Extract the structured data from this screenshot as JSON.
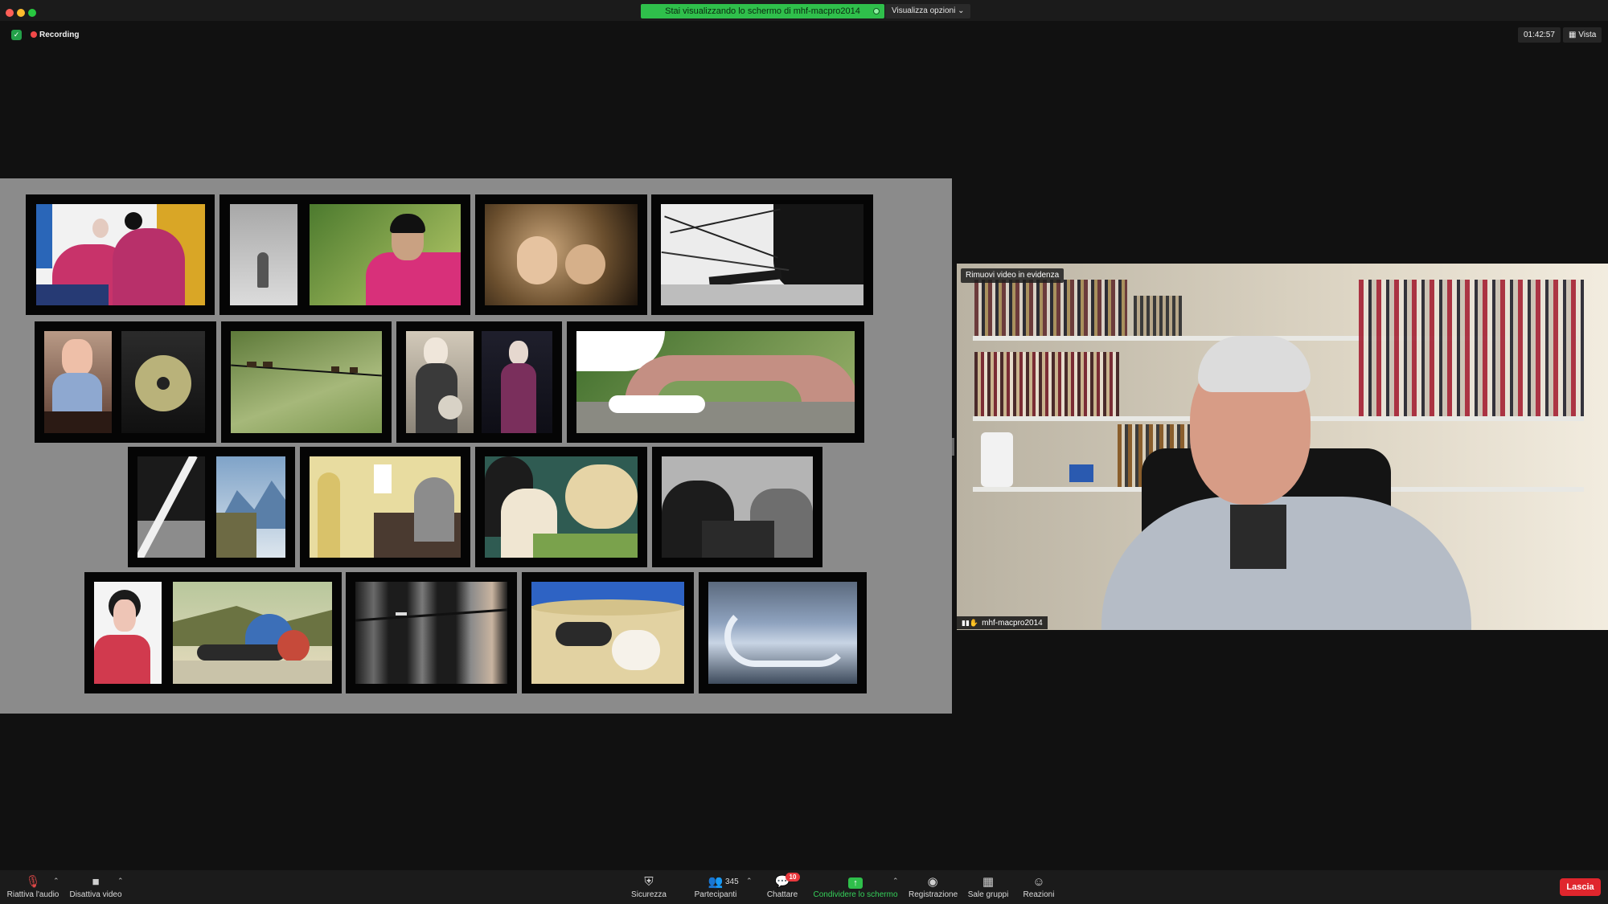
{
  "top_bar": {
    "share_banner": "Stai visualizzando lo schermo di mhf-macpro2014",
    "view_options": "Visualizza opzioni ⌄"
  },
  "status": {
    "recording_label": "Recording",
    "timer": "01:42:57",
    "view_button": "Vista"
  },
  "video": {
    "remove_spotlight": "Rimuovi video in evidenza",
    "participant_name": "mhf-macpro2014"
  },
  "toolbar": {
    "unmute": "Riattiva l'audio",
    "stop_video": "Disattiva video",
    "security": "Sicurezza",
    "participants": "Partecipanti",
    "participants_count": "345",
    "chat": "Chattare",
    "chat_badge": "10",
    "share_screen": "Condividere lo schermo",
    "record": "Registrazione",
    "breakout_rooms": "Sale gruppi",
    "reactions": "Reazioni",
    "leave": "Lascia"
  },
  "colors": {
    "accent_green": "#2fbf4b",
    "leave_red": "#e0262d",
    "recording_red": "#f04848",
    "background": "#111111"
  },
  "icons": [
    "mic-muted-icon",
    "camera-icon",
    "shield-icon",
    "participants-icon",
    "chat-icon",
    "share-screen-icon",
    "record-icon",
    "breakout-rooms-icon",
    "reactions-icon"
  ]
}
